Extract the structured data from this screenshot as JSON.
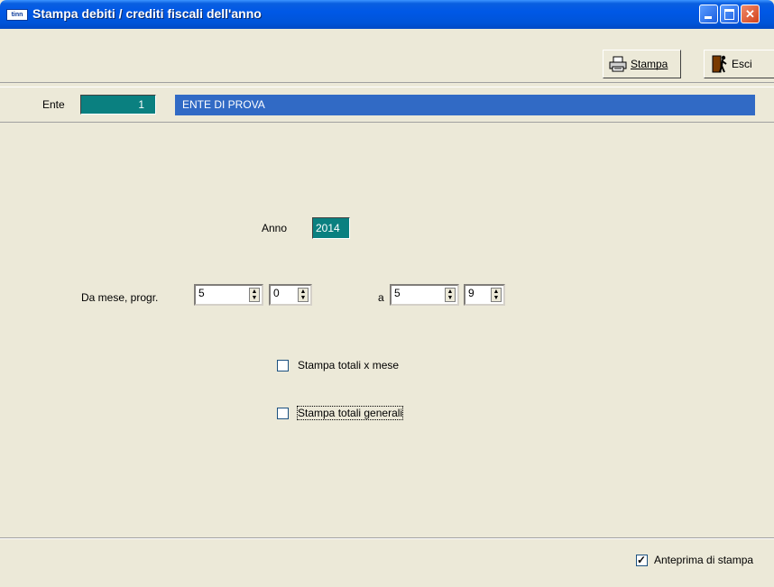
{
  "window": {
    "title": "Stampa debiti / crediti fiscali dell'anno",
    "icon_text": "tinn",
    "icons": [
      "minimize-icon",
      "maximize-icon",
      "close-icon"
    ]
  },
  "toolbar": {
    "stampa_label": "Stampa",
    "esci_label": "Esci"
  },
  "ente": {
    "label": "Ente",
    "code": "1",
    "name": "ENTE DI PROVA"
  },
  "form": {
    "anno_label": "Anno",
    "anno_value": "2014",
    "da_label": "Da mese, progr.",
    "da_mese": "5",
    "da_progr": "0",
    "a_label": "a",
    "a_mese": "5",
    "a_progr": "9",
    "stampa_totali_mese": {
      "label": "Stampa totali x mese",
      "checked": false
    },
    "stampa_totali_generali": {
      "label": "Stampa totali generali",
      "checked": false
    }
  },
  "footer": {
    "anteprima": {
      "label": "Anteprima di stampa",
      "checked": true
    }
  },
  "colors": {
    "title_bar": "#0054e3",
    "field_teal": "#0a8080",
    "selection_blue": "#316ac5",
    "face": "#ece9d8"
  }
}
